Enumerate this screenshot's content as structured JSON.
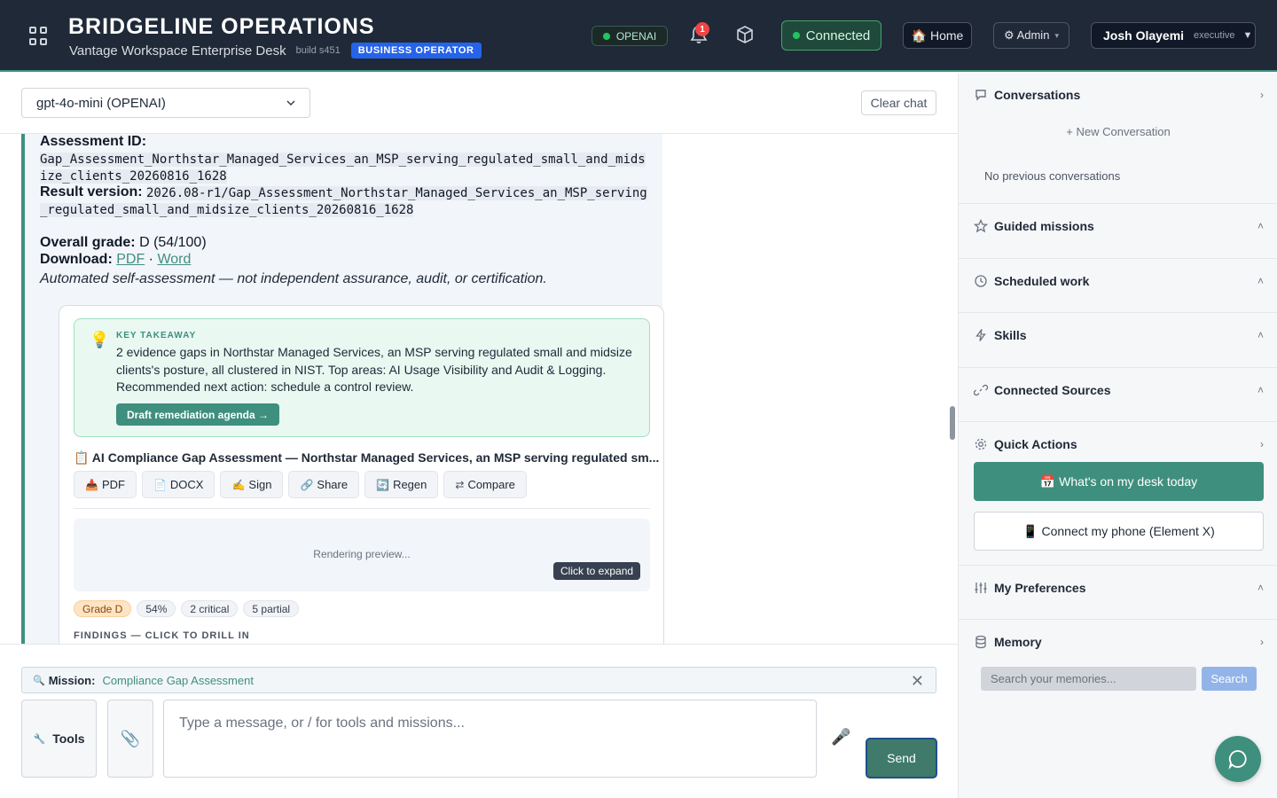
{
  "header": {
    "brand_title": "BRIDGELINE OPERATIONS",
    "brand_subtitle": "Vantage Workspace Enterprise Desk",
    "build": "build s451",
    "role_badge": "BUSINESS OPERATOR",
    "provider": "OPENAI",
    "notification_count": "1",
    "connection_status": "Connected",
    "home_label": "🏠 Home",
    "admin_label": "⚙ Admin",
    "admin_caret": "▾",
    "user_name": "Josh Olayemi",
    "user_role": "executive",
    "user_caret": "▼"
  },
  "toolbar": {
    "model_selected": "gpt-4o-mini (OPENAI)",
    "clear_label": "Clear chat"
  },
  "message": {
    "assessment_label": "Assessment ID:",
    "assessment_id": "Gap_Assessment_Northstar_Managed_Services_an_MSP_serving_regulated_small_and_midsize_clients_20260816_1628",
    "result_label": "Result version:",
    "result_version": "2026.08-r1/Gap_Assessment_Northstar_Managed_Services_an_MSP_serving_regulated_small_and_midsize_clients_20260816_1628",
    "grade_label": "Overall grade:",
    "grade_value": "D (54/100)",
    "download_label": "Download:",
    "download_pdf": "PDF",
    "download_sep": "·",
    "download_word": "Word",
    "disclaimer": "Automated self-assessment — not independent assurance, audit, or certification."
  },
  "card": {
    "takeaway_label": "KEY TAKEAWAY",
    "takeaway_text": "2 evidence gaps in Northstar Managed Services, an MSP serving regulated small and midsize clients's posture, all clustered in NIST. Top areas: AI Usage Visibility and Audit & Logging. Recommended next action: schedule a control review.",
    "takeaway_button": "Draft remediation agenda →",
    "report_title": "📋 AI Compliance Gap Assessment — Northstar Managed Services, an MSP serving regulated sm...",
    "actions": [
      {
        "icon": "📥",
        "label": "PDF"
      },
      {
        "icon": "📄",
        "label": "DOCX"
      },
      {
        "icon": "✍",
        "label": "Sign"
      },
      {
        "icon": "🔗",
        "label": "Share"
      },
      {
        "icon": "🔄",
        "label": "Regen"
      },
      {
        "icon": "⇄",
        "label": "Compare"
      }
    ],
    "preview_text": "Rendering preview...",
    "expand_tip": "Click to expand",
    "chips": [
      "Grade D",
      "54%",
      "2 critical",
      "5 partial"
    ],
    "findings_label": "FINDINGS — CLICK TO DRILL IN"
  },
  "composer": {
    "mission_icon": "🔍",
    "mission_label": "Mission:",
    "mission_value": "Compliance Gap Assessment",
    "mission_close": "✕",
    "tools_label": "Tools",
    "tools_icon": "🔧",
    "attach_icon": "📎",
    "input_placeholder": "Type a message, or / for tools and missions...",
    "mic_icon": "🎤",
    "send_label": "Send"
  },
  "sidebar": {
    "conversations_title": "Conversations",
    "new_conversation": "+ New Conversation",
    "no_conversations": "No previous conversations",
    "sections": [
      {
        "title": "Guided missions",
        "icon": "star-icon"
      },
      {
        "title": "Scheduled work",
        "icon": "clock-icon"
      },
      {
        "title": "Skills",
        "icon": "lightning-icon"
      },
      {
        "title": "Connected Sources",
        "icon": "link-icon"
      }
    ],
    "quick_actions_title": "Quick Actions",
    "quick_action_1": "📅 What's on my desk today",
    "quick_action_2": "📱 Connect my phone (Element X)",
    "preferences_title": "My Preferences",
    "memory_title": "Memory",
    "memory_placeholder": "Search your memories...",
    "memory_search": "Search"
  },
  "colors": {
    "accent": "#3f8f7e",
    "header_bg": "#1f2937",
    "role_badge": "#2563eb",
    "notification": "#ef4444"
  }
}
